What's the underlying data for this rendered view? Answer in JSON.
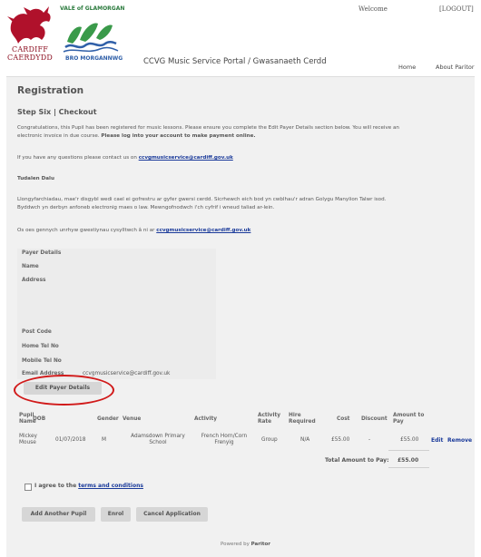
{
  "header": {
    "cardiff_logo_text": [
      "CARDIFF",
      "CAERDYDD"
    ],
    "vog_logo_top": "VALE of GLAMORGAN",
    "vog_logo_bottom": "BRO MORGANNWG",
    "portal_title": "CCVG Music Service Portal / Gwasanaeth Cerdd",
    "welcome": "Welcome",
    "logout": "[LOGOUT]",
    "nav": {
      "home": "Home",
      "about": "About Paritor"
    }
  },
  "page": {
    "title": "Registration",
    "step": "Step Six | Checkout",
    "congrats_en_1": "Congratulations, this Pupil has been registered for music lessons. Please ensure you complete the Edit Payer Details section below. You will receive an",
    "congrats_en_2": "electronic invoice in due course.",
    "congrats_en_bold": "Please log into your account to make payment online.",
    "questions_en": "If you have any questions please contact us on",
    "contact_email": "ccvgmusicservice@cardiff.gov.uk",
    "tudalen": "Tudalen Dalu",
    "welsh_1": "Llongyfarchiadau, mae'r disgybl wedi cael ei gofrestru ar gyfer gwersi cerdd. Sicrhewch eich bod yn cwblhau'r adran Golygu Manylion Talwr isod.",
    "welsh_2": "Byddwch yn derbyn anfoneb electronig maes o law. Mewngofnodwch i'ch cyfrif i wneud taliad ar-lein.",
    "questions_cy": "Os oes gennych unrhyw gwestiynau cysylltwch â ni ar"
  },
  "payer": {
    "heading": "Payer Details",
    "labels": {
      "name": "Name",
      "address": "Address",
      "post_code": "Post Code",
      "home_tel": "Home Tel No",
      "mobile_tel": "Mobile Tel No",
      "email": "Email Address"
    },
    "email_value": "ccvgmusicservice@cardiff.gov.uk",
    "edit_button": "Edit Payer Details"
  },
  "table": {
    "headers": {
      "pupil": [
        "Pupil",
        "Name"
      ],
      "dob": "DOB",
      "gender": "Gender",
      "venue": "Venue",
      "activity": "Activity",
      "activity_rate": [
        "Activity",
        "Rate"
      ],
      "hire": [
        "Hire",
        "Required"
      ],
      "cost": "Cost",
      "discount": "Discount",
      "amount": [
        "Amount to",
        "Pay"
      ]
    },
    "row": {
      "pupil": [
        "Mickey",
        "Mouse"
      ],
      "dob": "01/07/2018",
      "gender": "M",
      "venue": [
        "Adamsdown Primary",
        "School"
      ],
      "activity": [
        "French Horn/Corn",
        "Frenyig"
      ],
      "rate": "Group",
      "hire": "N/A",
      "cost": "£55.00",
      "discount": "-",
      "amount": "£55.00",
      "edit": "Edit",
      "remove": "Remove"
    },
    "total_label": "Total Amount to Pay:",
    "total_value": "£55.00"
  },
  "agree": {
    "prefix": "I agree to the",
    "link": "terms and conditions"
  },
  "buttons": {
    "add_pupil": "Add Another Pupil",
    "enrol": "Enrol",
    "cancel": "Cancel Application"
  },
  "footer": {
    "powered": "Powered by",
    "brand": "Paritor"
  }
}
